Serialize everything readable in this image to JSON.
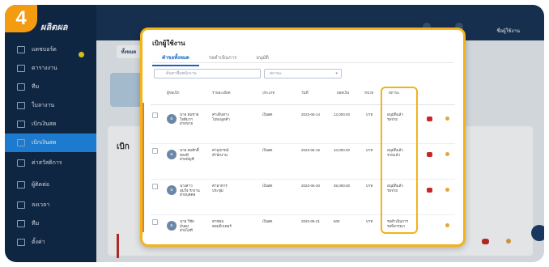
{
  "step": {
    "number": "4"
  },
  "app": {
    "logo": "ผลิตผล",
    "user": "ชื่อผู้ใช้งาน",
    "page_tab": "ทั้งหมด",
    "card_title": "เบิก",
    "sidebar": [
      {
        "label": "แดชบอร์ด",
        "active": false
      },
      {
        "label": "ตารางงาน",
        "active": false
      },
      {
        "label": "ทีม",
        "active": false
      },
      {
        "label": "ใบลางาน",
        "active": false
      },
      {
        "label": "เบิกเงินสด",
        "active": false
      },
      {
        "label": "เบิกเงินสด",
        "active": true
      },
      {
        "label": "ค่าสวัสดิการ",
        "active": false
      },
      {
        "label": "ผู้ติดต่อ",
        "active": false
      },
      {
        "label": "ลงเวลา",
        "active": false
      },
      {
        "label": "ทีม",
        "active": false
      },
      {
        "label": "ตั้งค่า",
        "active": false
      }
    ]
  },
  "modal": {
    "title": "เบิกผู้ใช้งาน",
    "tabs": [
      {
        "label": "คำขอทั้งหมด",
        "active": true
      },
      {
        "label": "รอดำเนินการ",
        "active": false
      },
      {
        "label": "อนุมัติ",
        "active": false
      }
    ],
    "search": {
      "placeholder": "ค้นหาชื่อพนักงาน"
    },
    "filter": {
      "value": "สถานะ"
    },
    "columns": [
      "ผู้ขอเบิก",
      "รายละเอียด",
      "ประเภท",
      "วันที่",
      "ยอดเงิน",
      "หน่วย",
      "สถานะ"
    ],
    "rows": [
      {
        "avatar": "ผ",
        "name": [
          "นาย สมชาย",
          "ใจดีมาก",
          "ฝ่ายขาย"
        ],
        "detail": [
          "ค่าเดินทาง",
          "ไปพบลูกค้า"
        ],
        "type": "เงินสด",
        "date": "2023-06-14",
        "amount": "12,000.00",
        "unit": "บาท",
        "status": [
          "อนุมัติแล้ว",
          "รอจ่าย"
        ]
      },
      {
        "avatar": "ผ",
        "name": [
          "นาย สมศักดิ์",
          "ทองดี",
          "ฝ่ายบัญชี"
        ],
        "detail": [
          "ค่าอุปกรณ์",
          "สำนักงาน"
        ],
        "type": "เงินสด",
        "date": "2023-06-15",
        "amount": "10,000.00",
        "unit": "บาท",
        "status": [
          "อนุมัติแล้ว",
          "จ่ายแล้ว"
        ]
      },
      {
        "avatar": "ผ",
        "name": [
          "นางสาว",
          "สมใจ รักงาน",
          "ฝ่ายบุคคล"
        ],
        "detail": [
          "ค่าอาหาร",
          "ประชุม"
        ],
        "type": "เงินสด",
        "date": "2023-06-20",
        "amount": "35,000.00",
        "unit": "บาท",
        "status": [
          "อนุมัติแล้ว",
          "รอจ่าย"
        ]
      },
      {
        "avatar": "ผ",
        "name": [
          "นาย วิชัย",
          "มั่นคง",
          "ฝ่ายไอที"
        ],
        "detail": [
          "ค่าซ่อม",
          "คอมพิวเตอร์"
        ],
        "type": "เงินสด",
        "date": "2023-06-21",
        "amount": "500",
        "unit": "บาท",
        "status": [
          "รอดำเนินการ",
          "รอพิจารณา"
        ]
      }
    ]
  },
  "colors": {
    "highlight": "#f2b31b",
    "step_badge": "#f39c12",
    "sidebar": "#0f2747",
    "active_nav": "#1e88e5"
  }
}
